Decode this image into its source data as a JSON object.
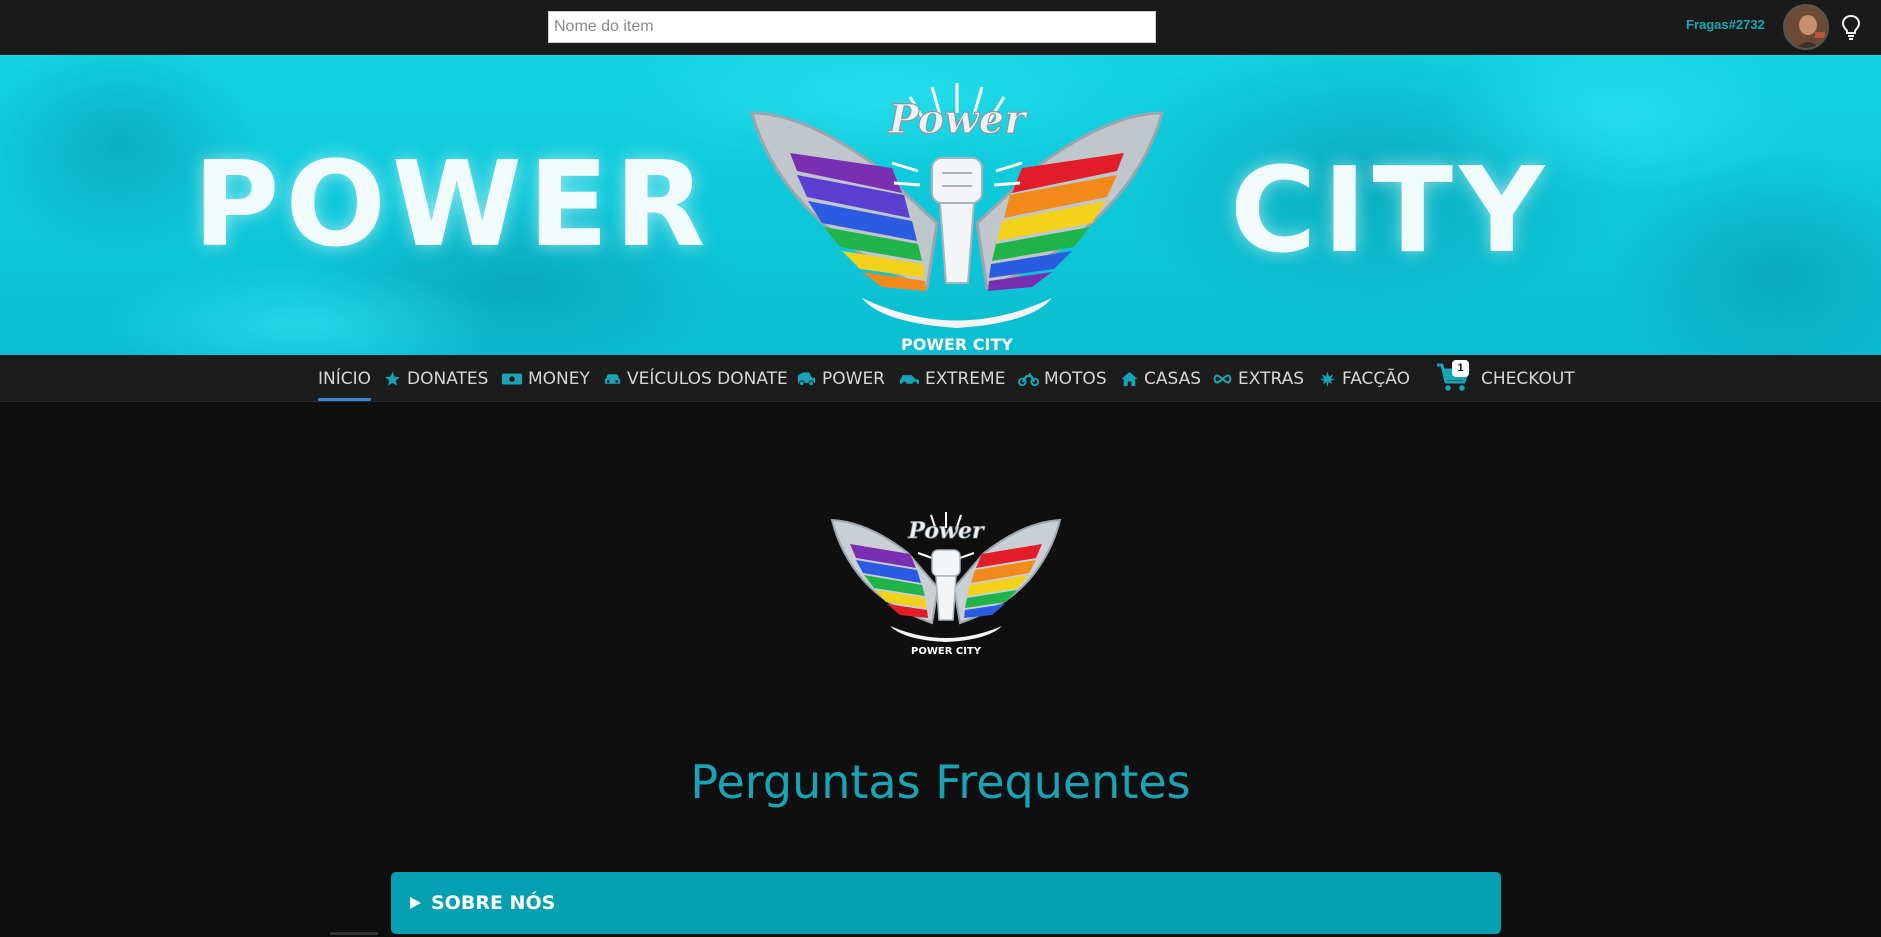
{
  "search": {
    "placeholder": "Nome do item",
    "value": ""
  },
  "user": {
    "name": "Fragas#2732"
  },
  "banner": {
    "left_word": "POWER",
    "right_word": "CITY",
    "logo_script": "Power",
    "logo_caption": "POWER CITY"
  },
  "nav": {
    "items": [
      {
        "label": "INÍCIO",
        "icon": "none",
        "active": true
      },
      {
        "label": "DONATES",
        "icon": "star-icon"
      },
      {
        "label": "MONEY",
        "icon": "money-icon"
      },
      {
        "label": "VEÍCULOS DONATE",
        "icon": "car-icon"
      },
      {
        "label": "POWER",
        "icon": "truck-icon"
      },
      {
        "label": "EXTREME",
        "icon": "car-side-icon"
      },
      {
        "label": "MOTOS",
        "icon": "motorcycle-icon"
      },
      {
        "label": "CASAS",
        "icon": "home-icon"
      },
      {
        "label": "EXTRAS",
        "icon": "infinity-icon"
      },
      {
        "label": "FACÇÃO",
        "icon": "leaf-icon"
      }
    ],
    "cart_count": "1",
    "checkout": "CHECKOUT"
  },
  "main": {
    "logo_script": "Power",
    "logo_caption": "POWER CITY",
    "faq_title": "Perguntas Frequentes",
    "faq_items": [
      {
        "label": "SOBRE NÓS"
      }
    ]
  },
  "colors": {
    "accent": "#19a4b6",
    "accordion": "#04a0b1",
    "banner": "#12d3e4",
    "active_underline": "#3a86d4"
  }
}
